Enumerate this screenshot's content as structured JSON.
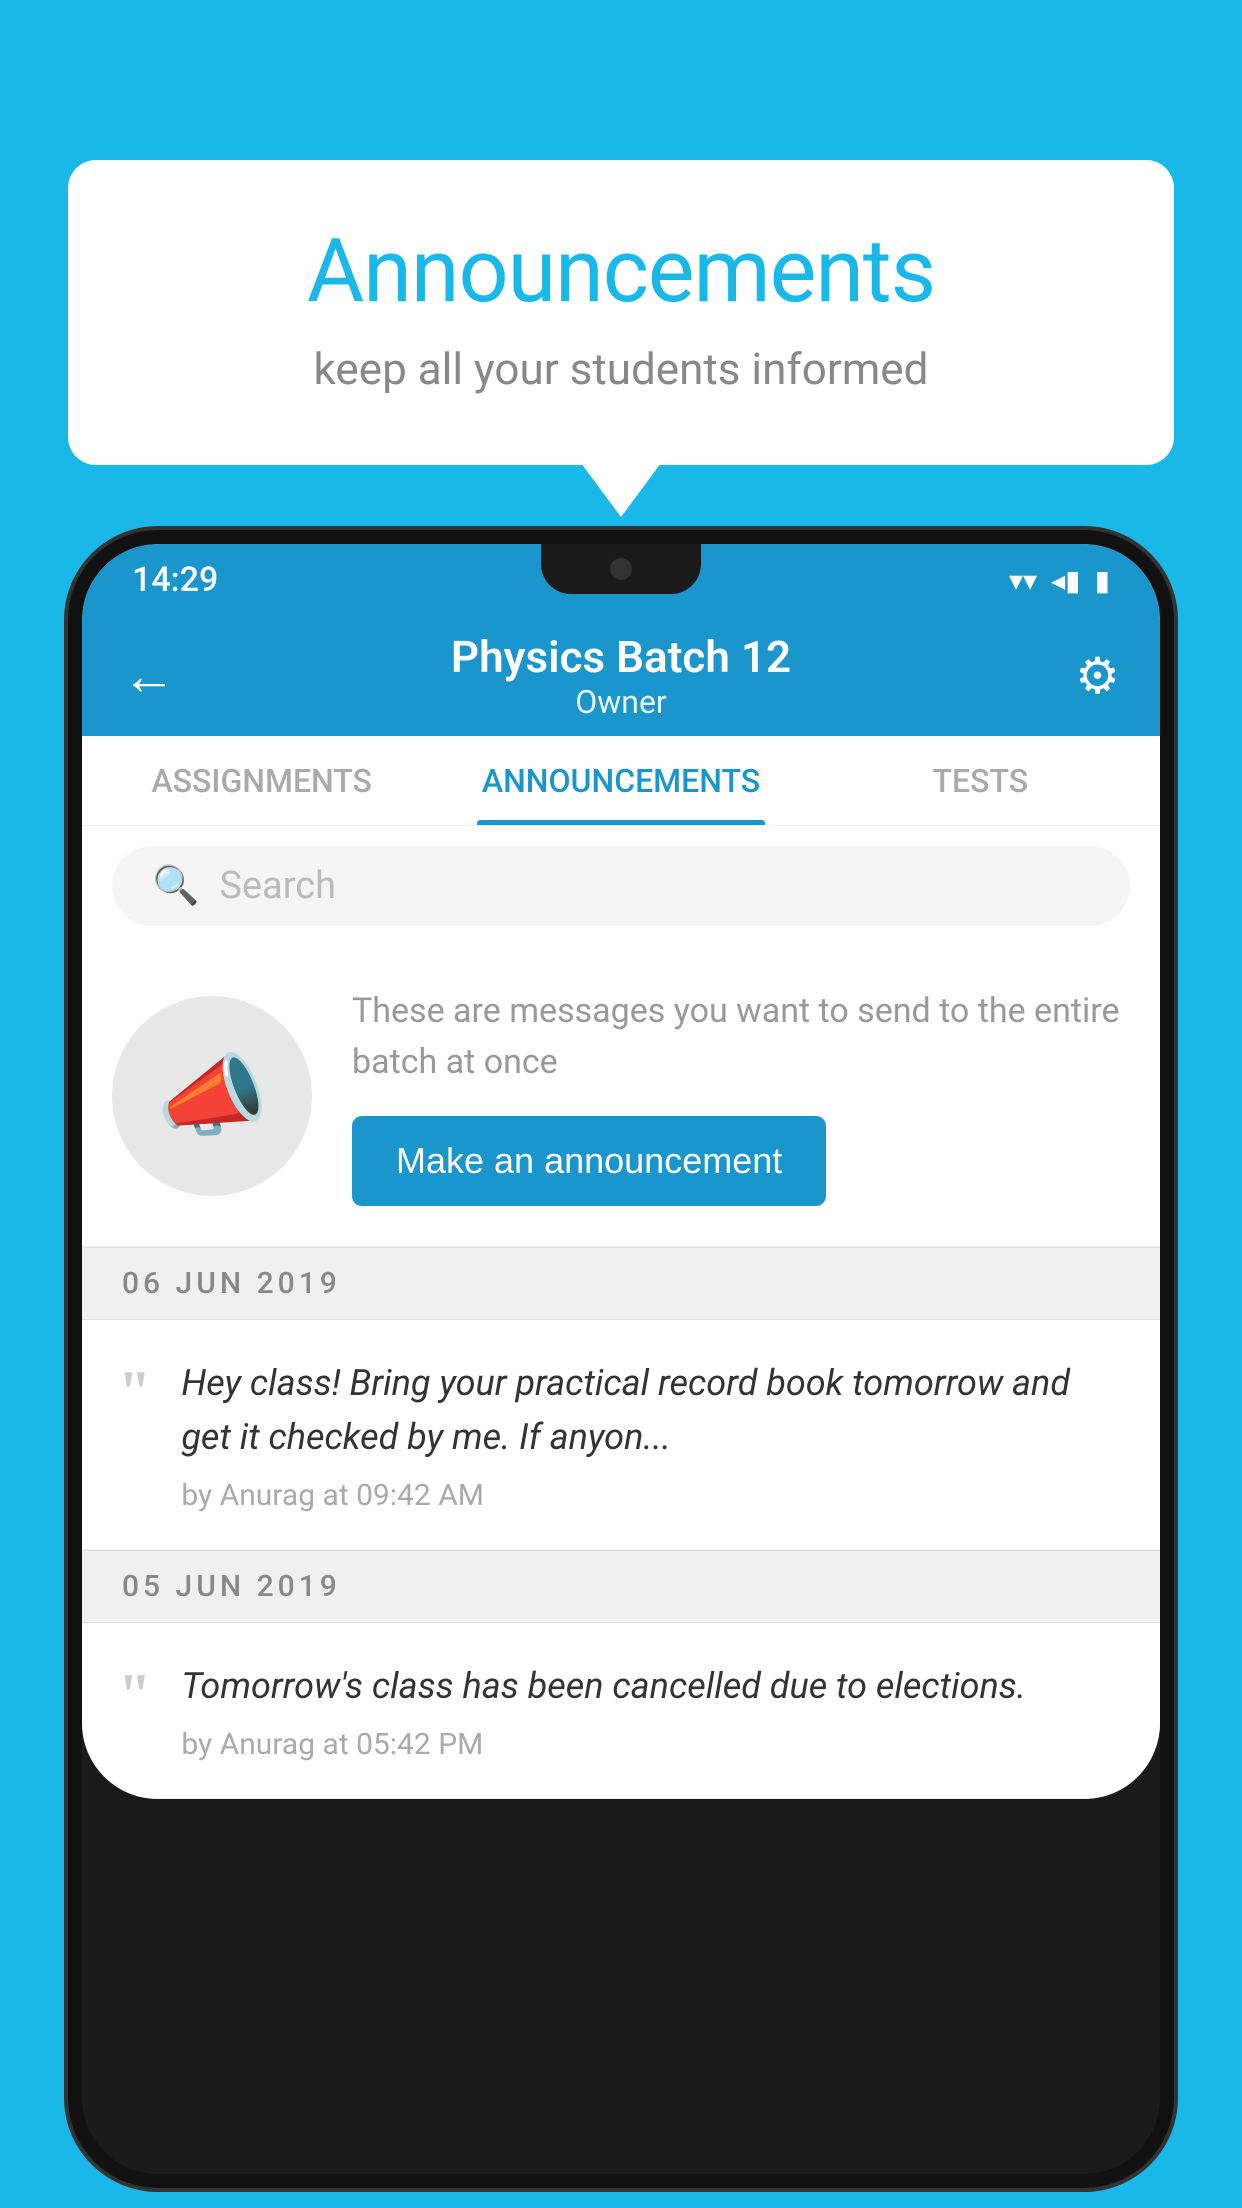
{
  "background_color": "#1ab8e8",
  "speech_bubble": {
    "title": "Announcements",
    "subtitle": "keep all your students informed"
  },
  "phone": {
    "status_bar": {
      "time": "14:29",
      "wifi": "▼",
      "signal": "◀",
      "battery": "▮"
    },
    "top_bar": {
      "title": "Physics Batch 12",
      "subtitle": "Owner",
      "back_label": "←",
      "gear_label": "⚙"
    },
    "tabs": [
      {
        "label": "ASSIGNMENTS",
        "active": false
      },
      {
        "label": "ANNOUNCEMENTS",
        "active": true
      },
      {
        "label": "TESTS",
        "active": false
      }
    ],
    "search": {
      "placeholder": "Search"
    },
    "announcement_prompt": {
      "description": "These are messages you want to send to the entire batch at once",
      "button_label": "Make an announcement"
    },
    "announcements": [
      {
        "date": "06  JUN  2019",
        "text": "Hey class! Bring your practical record book tomorrow and get it checked by me. If anyon...",
        "meta": "by Anurag at 09:42 AM"
      },
      {
        "date": "05  JUN  2019",
        "text": "Tomorrow's class has been cancelled due to elections.",
        "meta": "by Anurag at 05:42 PM"
      }
    ]
  }
}
